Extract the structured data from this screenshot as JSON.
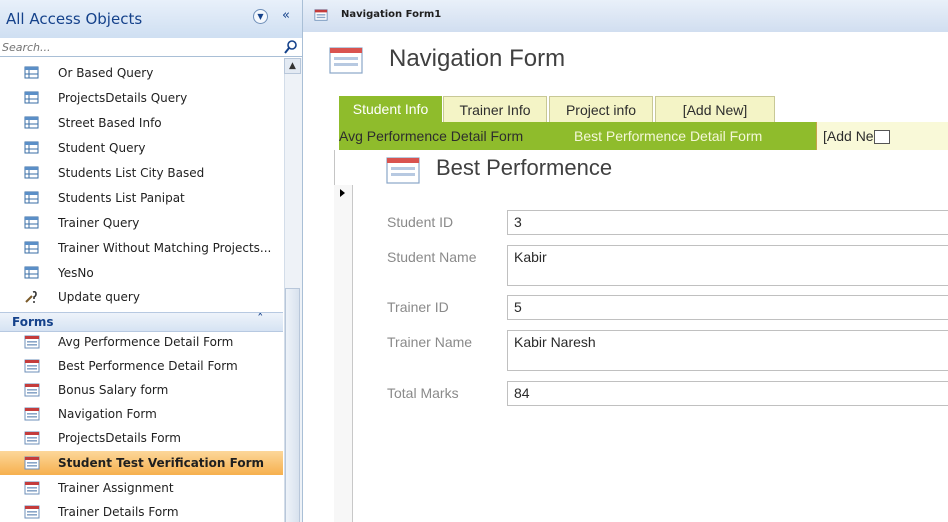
{
  "nav": {
    "title": "All Access Objects",
    "search_placeholder": "Search...",
    "forms_group_label": "Forms",
    "queries": [
      {
        "label": "Or Based Query"
      },
      {
        "label": "ProjectsDetails Query"
      },
      {
        "label": "Street Based Info"
      },
      {
        "label": "Student Query"
      },
      {
        "label": "Students List City Based"
      },
      {
        "label": "Students List Panipat"
      },
      {
        "label": "Trainer Query"
      },
      {
        "label": "Trainer Without Matching Projects..."
      },
      {
        "label": "YesNo"
      },
      {
        "label": "Update query"
      }
    ],
    "forms": [
      {
        "label": "Avg Performence Detail Form"
      },
      {
        "label": "Best Performence Detail Form"
      },
      {
        "label": "Bonus Salary form"
      },
      {
        "label": "Navigation Form"
      },
      {
        "label": "ProjectsDetails Form"
      },
      {
        "label": "Student Test Verification Form"
      },
      {
        "label": "Trainer Assignment"
      },
      {
        "label": "Trainer Details Form"
      }
    ],
    "selected_form": "Student Test Verification Form"
  },
  "document": {
    "tab_label": "Navigation Form1",
    "form_title": "Navigation Form"
  },
  "top_tabs": [
    {
      "label": "Student Info"
    },
    {
      "label": "Trainer Info"
    },
    {
      "label": "Project info"
    },
    {
      "label": "[Add New]"
    }
  ],
  "sub_tabs": [
    {
      "label": "Avg Performence Detail Form"
    },
    {
      "label": "Best Performence Detail Form"
    },
    {
      "label": "[Add Ne"
    }
  ],
  "subform": {
    "title": "Best Performence",
    "fields": {
      "student_id": {
        "label": "Student ID",
        "value": "3"
      },
      "student_name": {
        "label": "Student Name",
        "value": "Kabir"
      },
      "trainer_id": {
        "label": "Trainer ID",
        "value": "5"
      },
      "trainer_name": {
        "label": "Trainer Name",
        "value": "Kabir Naresh"
      },
      "total_marks": {
        "label": "Total Marks",
        "value": "84"
      }
    }
  },
  "colors": {
    "accent_green": "#8fbc2c",
    "selected_orange": "#f6b04e",
    "pane_header_blue": "#cfdff2"
  }
}
